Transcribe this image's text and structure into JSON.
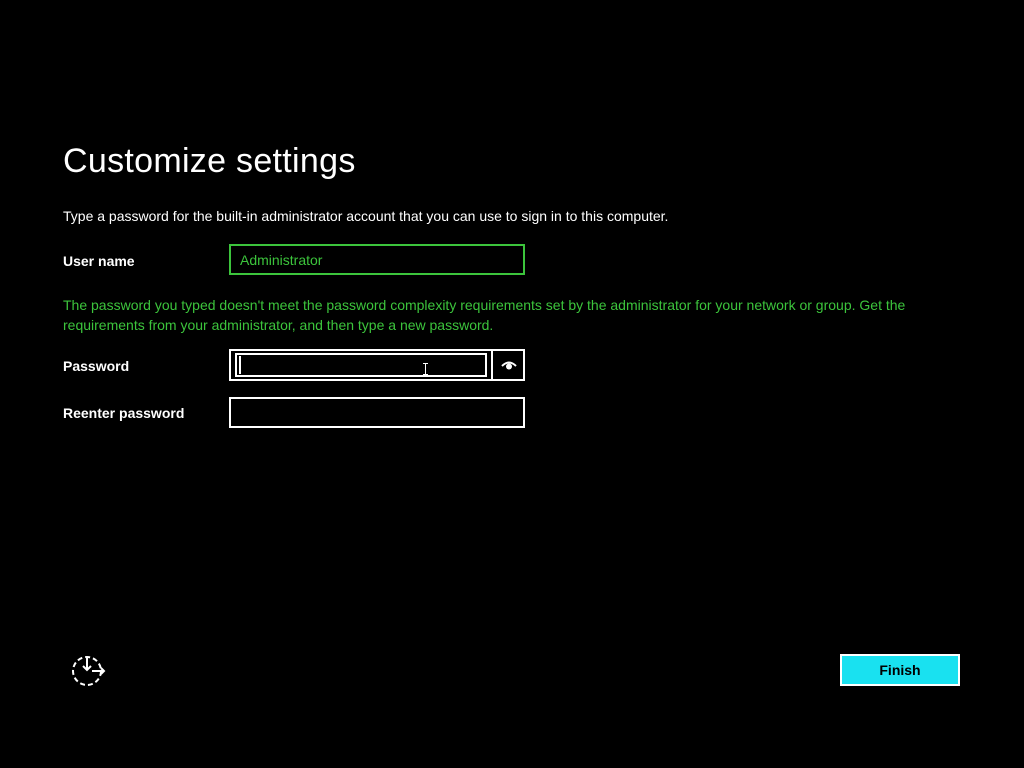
{
  "page": {
    "title": "Customize settings",
    "instructions": "Type a password for the built-in administrator account that you can use to sign in to this computer."
  },
  "form": {
    "username_label": "User name",
    "username_value": "Administrator",
    "error_message": "The password you typed doesn't meet the password complexity requirements set by the administrator for your network or group. Get the requirements from your administrator, and then type a new password.",
    "password_label": "Password",
    "password_value": "",
    "reenter_label": "Reenter password",
    "reenter_value": ""
  },
  "footer": {
    "finish_label": "Finish",
    "accessibility_icon": "ease-of-access-icon"
  },
  "colors": {
    "background": "#000000",
    "accent_green": "#3cc43c",
    "finish_button": "#19e1f0",
    "text": "#ffffff"
  },
  "icons": {
    "reveal": "eye-icon"
  }
}
